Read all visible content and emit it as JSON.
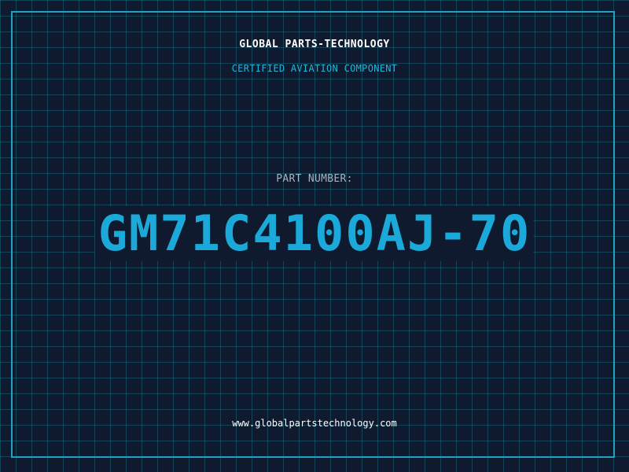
{
  "header": {
    "company": "GLOBAL PARTS-TECHNOLOGY",
    "tagline": "CERTIFIED AVIATION COMPONENT"
  },
  "part": {
    "label": "PART NUMBER:",
    "number": "GM71C4100AJ-70"
  },
  "footer": {
    "website": "www.globalpartstechnology.com"
  },
  "colors": {
    "background": "#0f1a2e",
    "accent": "#1aa9d8",
    "frame": "#1fa2c4",
    "grid": "#18788c"
  }
}
